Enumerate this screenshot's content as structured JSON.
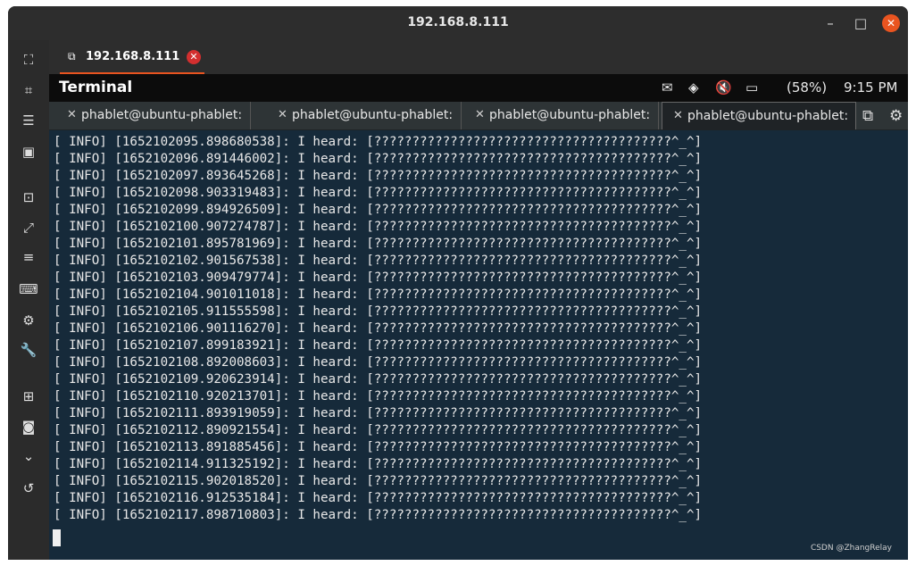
{
  "window": {
    "title": "192.168.8.111"
  },
  "connection_tab": {
    "label": "192.168.8.111"
  },
  "status_bar": {
    "app_title": "Terminal",
    "battery": "(58%)",
    "time": "9:15 PM"
  },
  "terminal_tabs": [
    {
      "label": "phablet@ubuntu-phablet: ~"
    },
    {
      "label": "phablet@ubuntu-phablet: ~"
    },
    {
      "label": "phablet@ubuntu-phablet: ~"
    },
    {
      "label": "phablet@ubuntu-phablet: ~"
    }
  ],
  "log_lines": [
    "[ INFO] [1652102095.898680538]: I heard: [???????????????????????????????????????^_^]",
    "[ INFO] [1652102096.891446002]: I heard: [???????????????????????????????????????^_^]",
    "[ INFO] [1652102097.893645268]: I heard: [???????????????????????????????????????^_^]",
    "[ INFO] [1652102098.903319483]: I heard: [???????????????????????????????????????^_^]",
    "[ INFO] [1652102099.894926509]: I heard: [???????????????????????????????????????^_^]",
    "[ INFO] [1652102100.907274787]: I heard: [???????????????????????????????????????^_^]",
    "[ INFO] [1652102101.895781969]: I heard: [???????????????????????????????????????^_^]",
    "[ INFO] [1652102102.901567538]: I heard: [???????????????????????????????????????^_^]",
    "[ INFO] [1652102103.909479774]: I heard: [???????????????????????????????????????^_^]",
    "[ INFO] [1652102104.901011018]: I heard: [???????????????????????????????????????^_^]",
    "[ INFO] [1652102105.911555598]: I heard: [???????????????????????????????????????^_^]",
    "[ INFO] [1652102106.901116270]: I heard: [???????????????????????????????????????^_^]",
    "[ INFO] [1652102107.899183921]: I heard: [???????????????????????????????????????^_^]",
    "[ INFO] [1652102108.892008603]: I heard: [???????????????????????????????????????^_^]",
    "[ INFO] [1652102109.920623914]: I heard: [???????????????????????????????????????^_^]",
    "[ INFO] [1652102110.920213701]: I heard: [???????????????????????????????????????^_^]",
    "[ INFO] [1652102111.893919059]: I heard: [???????????????????????????????????????^_^]",
    "[ INFO] [1652102112.890921554]: I heard: [???????????????????????????????????????^_^]",
    "[ INFO] [1652102113.891885456]: I heard: [???????????????????????????????????????^_^]",
    "[ INFO] [1652102114.911325192]: I heard: [???????????????????????????????????????^_^]",
    "[ INFO] [1652102115.902018520]: I heard: [???????????????????????????????????????^_^]",
    "[ INFO] [1652102116.912535184]: I heard: [???????????????????????????????????????^_^]",
    "[ INFO] [1652102117.898710803]: I heard: [???????????????????????????????????????^_^]"
  ],
  "watermark": "CSDN @ZhangRelay",
  "icons": [
    "fullscreen-icon",
    "fit-screen-icon",
    "menu-icon",
    "display-icon",
    "screenshot-icon",
    "expand-icon",
    "list-icon",
    "keyboard-icon",
    "settings-icon",
    "wrench-icon",
    "new-window-icon",
    "camera-icon",
    "chevron-down-icon",
    "disconnect-icon",
    "mail-icon",
    "wifi-icon",
    "volume-mute-icon",
    "battery-icon",
    "copy-icon",
    "gear-icon"
  ],
  "colors": {
    "accent": "#e95420",
    "terminal_bg": "#162a3a"
  }
}
